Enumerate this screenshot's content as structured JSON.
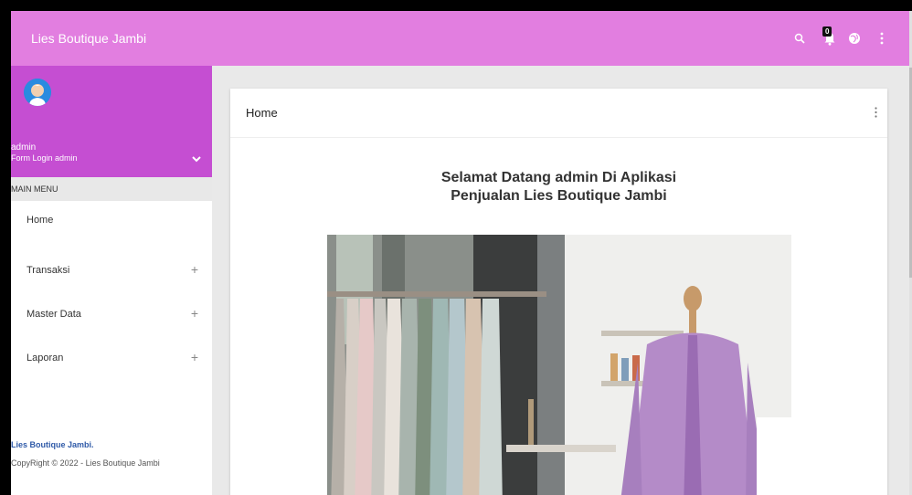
{
  "app": {
    "title": "Lies Boutique Jambi"
  },
  "topbar": {
    "icons": [
      "search-icon",
      "notification-bell-icon",
      "globe-icon",
      "more-vert-icon"
    ],
    "notification_count": "0"
  },
  "sidebar": {
    "user": {
      "name": "admin",
      "subtitle": "Form Login admin"
    },
    "section_label": "MAIN MENU",
    "items": [
      {
        "label": "Home",
        "expandable": false
      },
      {
        "label": "Transaksi",
        "expandable": true,
        "expand_symbol": "+"
      },
      {
        "label": "Master Data",
        "expandable": true,
        "expand_symbol": "+"
      },
      {
        "label": "Laporan",
        "expandable": true,
        "expand_symbol": "+"
      }
    ],
    "footer": {
      "title": "Lies Boutique Jambi.",
      "copyright": "CopyRight © 2022 - Lies Boutique Jambi"
    }
  },
  "main": {
    "card_title": "Home",
    "welcome_line1": "Selamat Datang admin Di Aplikasi",
    "welcome_line2": "Penjualan Lies Boutique Jambi"
  },
  "colors": {
    "topbar": "#e27ee0",
    "profile": "#c54ed2",
    "footer_title": "#2f5aa8"
  }
}
